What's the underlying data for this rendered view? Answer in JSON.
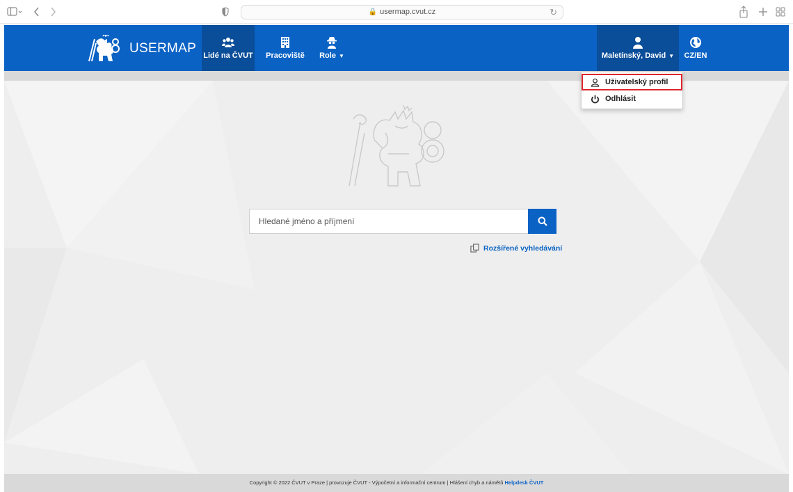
{
  "browser": {
    "url": "usermap.cvut.cz"
  },
  "brand": {
    "name": "USERMAP"
  },
  "nav": {
    "people": "Lidé na ČVUT",
    "workplaces": "Pracoviště",
    "roles": "Role",
    "user": "Maletínský, David",
    "language": "CZ/EN"
  },
  "user_menu": {
    "profile": "Uživatelský profil",
    "logout": "Odhlásit"
  },
  "search": {
    "placeholder": "Hledané jméno a příjmení",
    "advanced_link": "Rozšířené vyhledávání"
  },
  "footer": {
    "text": "Copyright © 2022 ČVUT v Praze | provozuje ČVUT - Výpočetní a informační centrum | Hlášení chyb a námětů",
    "link": "Helpdesk ČVUT"
  },
  "colors": {
    "primary": "#0a62c4",
    "active_nav": "#0a4d99",
    "highlight": "#e0262d"
  }
}
